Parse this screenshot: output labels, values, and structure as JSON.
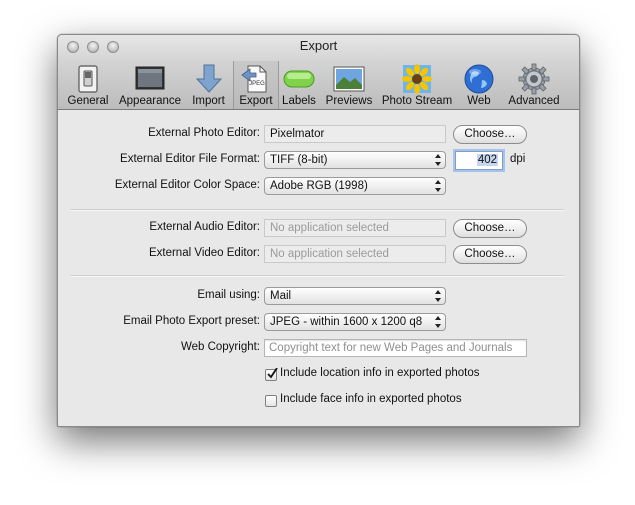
{
  "window": {
    "title": "Export"
  },
  "toolbar": {
    "items": [
      {
        "label": "General",
        "icon": "switch-icon"
      },
      {
        "label": "Appearance",
        "icon": "monitor-icon"
      },
      {
        "label": "Import",
        "icon": "import-arrow-icon"
      },
      {
        "label": "Export",
        "icon": "jpeg-file-icon",
        "active": true,
        "icon_text": "JPEG"
      },
      {
        "label": "Labels",
        "icon": "green-label-icon"
      },
      {
        "label": "Previews",
        "icon": "landscape-photo-icon"
      },
      {
        "label": "Photo Stream",
        "icon": "sunflower-icon"
      },
      {
        "label": "Web",
        "icon": "globe-icon"
      },
      {
        "label": "Advanced",
        "icon": "gear-icon"
      }
    ]
  },
  "editor": {
    "photo_editor_label": "External Photo Editor:",
    "photo_editor_value": "Pixelmator",
    "file_format_label": "External Editor File Format:",
    "file_format_value": "TIFF (8-bit)",
    "dpi_value": "402",
    "dpi_unit": "dpi",
    "color_space_label": "External Editor Color Space:",
    "color_space_value": "Adobe RGB (1998)",
    "choose_label": "Choose…"
  },
  "media": {
    "audio_label": "External Audio Editor:",
    "audio_value": "No application selected",
    "video_label": "External Video Editor:",
    "video_value": "No application selected",
    "choose_label": "Choose…"
  },
  "email": {
    "using_label": "Email using:",
    "using_value": "Mail",
    "preset_label": "Email Photo Export preset:",
    "preset_value": "JPEG - within 1600 x 1200 q8",
    "copyright_label": "Web Copyright:",
    "copyright_placeholder": "Copyright text for new Web Pages and Journals",
    "location_label": "Include location info in exported photos",
    "location_checked": true,
    "face_label": "Include face info in exported photos",
    "face_checked": false
  }
}
